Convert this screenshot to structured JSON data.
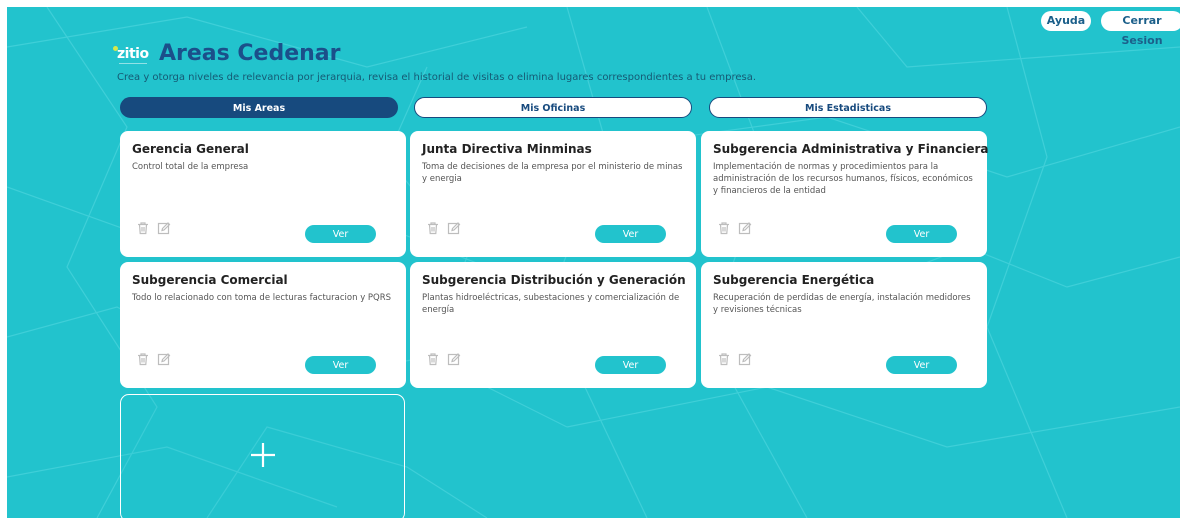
{
  "header": {
    "help_label": "Ayuda",
    "logout_label": "Cerrar Sesion"
  },
  "logo": {
    "text": "zitio",
    "color": "#d6e84a"
  },
  "page": {
    "title": "Areas Cedenar",
    "subtitle": "Crea y otorga niveles de relevancia por jerarquia, revisa el historial de visitas o elimina lugares correspondientes a tu empresa."
  },
  "tabs": [
    {
      "label": "Mis Areas",
      "active": true
    },
    {
      "label": "Mis Oficinas",
      "active": false
    },
    {
      "label": "Mis Estadisticas",
      "active": false
    }
  ],
  "cards": [
    {
      "title": "Gerencia General",
      "description": "Control total de la empresa",
      "view_label": "Ver",
      "delete_icon": "trash-icon",
      "edit_icon": "edit-icon"
    },
    {
      "title": "Junta Directiva Minminas",
      "description": "Toma de decisiones de la empresa por el ministerio de minas y energia",
      "view_label": "Ver",
      "delete_icon": "trash-icon",
      "edit_icon": "edit-icon"
    },
    {
      "title": "Subgerencia Administrativa y Financiera",
      "description": "Implementación de normas y procedimientos para la administración de los recursos humanos, físicos, económicos y financieros de la entidad",
      "view_label": "Ver",
      "delete_icon": "trash-icon",
      "edit_icon": "edit-icon"
    },
    {
      "title": "Subgerencia Comercial",
      "description": "Todo lo relacionado con toma de lecturas facturacion y PQRS",
      "view_label": "Ver",
      "delete_icon": "trash-icon",
      "edit_icon": "edit-icon"
    },
    {
      "title": "Subgerencia Distribución y Generación",
      "description": "Plantas hidroeléctricas, subestaciones y comercialización de energía",
      "view_label": "Ver",
      "delete_icon": "trash-icon",
      "edit_icon": "edit-icon"
    },
    {
      "title": "Subgerencia Energética",
      "description": "Recuperación de perdidas de energía, instalación medidores y revisiones técnicas",
      "view_label": "Ver",
      "delete_icon": "trash-icon",
      "edit_icon": "edit-icon"
    }
  ],
  "add_card": {
    "icon": "plus-icon"
  },
  "colors": {
    "background": "#22c3cd",
    "primary": "#174a7e",
    "title": "#1b4f8a",
    "card": "#ffffff"
  }
}
